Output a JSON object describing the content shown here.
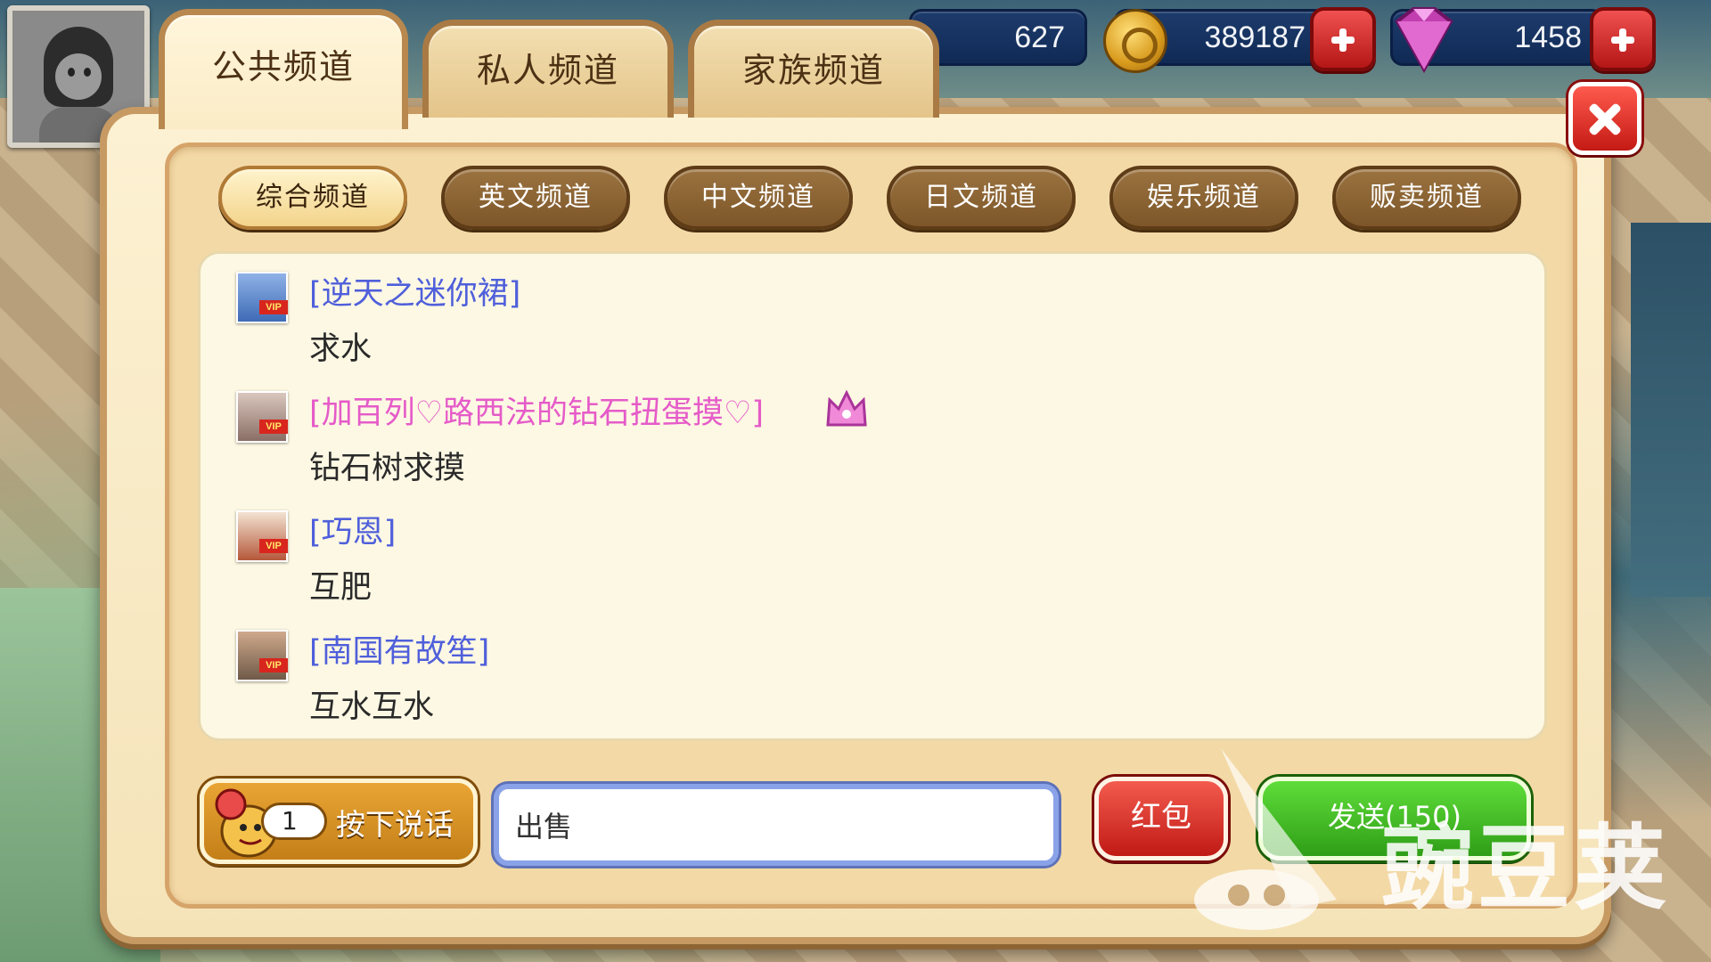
{
  "resources": {
    "hearts": "627",
    "coins": "389187",
    "gems": "1458"
  },
  "tabs": [
    {
      "label": "公共频道"
    },
    {
      "label": "私人频道"
    },
    {
      "label": "家族频道"
    }
  ],
  "channels": [
    {
      "label": "综合频道"
    },
    {
      "label": "英文频道"
    },
    {
      "label": "中文频道"
    },
    {
      "label": "日文频道"
    },
    {
      "label": "娱乐频道"
    },
    {
      "label": "贩卖频道"
    }
  ],
  "messages": [
    {
      "name": "[逆天之迷你裙]",
      "text": "求水",
      "vip": "VIP"
    },
    {
      "name": "[加百列♡路西法的钻石扭蛋摸♡]",
      "text": "钻石树求摸",
      "vip": "VIP"
    },
    {
      "name": "[巧恩]",
      "text": "互肥",
      "vip": "VIP"
    },
    {
      "name": "[南国有故笙]",
      "text": "互水互水",
      "vip": "VIP"
    }
  ],
  "composer": {
    "voice_count": "1",
    "voice_label": "按下说话",
    "input_value": "出售",
    "redpack_label": "红包",
    "send_label": "发送(150)"
  },
  "watermark": "豌豆荚",
  "colors": {
    "panel": "#fcf1d3",
    "username": "#4f5fdb",
    "username_vip": "#e55bc9",
    "send": "#2f9e17",
    "close": "#c41a14"
  }
}
